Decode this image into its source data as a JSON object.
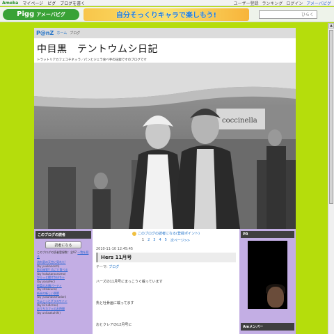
{
  "topbar": {
    "logo": "Ameba",
    "links": [
      "マイページ",
      "ピグ",
      "ブログを書く"
    ],
    "right_links": [
      "ユーザー登録",
      "ランキング",
      "ログイン"
    ],
    "right_highlight": "アメーバピグ"
  },
  "banner": {
    "pigg_mark": "Pigg",
    "pigg_label": "アメーバピグ",
    "ad_text": "自分そっくりキャラで楽しもう!",
    "search_placeholder": "ひらく"
  },
  "crumb": {
    "brand": "P@nZ",
    "home": "ホーム",
    "current": "ブログ"
  },
  "header": {
    "title": "中目黒　テントウムシ日記",
    "description": "トラットリアカフェコチネッラ／パンとジェラ食べ手の記録ですのブログです"
  },
  "photo": {
    "sign_text": "coccinella"
  },
  "left": {
    "reader_head": "このブログの読者",
    "reader_button": "読者になる",
    "note": "このブログの読者登録数：全97",
    "note_link": "一覧を見る",
    "entries": [
      {
        "title": "流れ星の天空に見れた!",
        "author": "(by yuukanosm)"
      },
      {
        "title": "秋の味覚!! 丸ごと食べる",
        "author": "(by hakukarounomo)"
      },
      {
        "title": "からっと揚げかぼちゃ",
        "author": "(by yasu9ec)"
      },
      {
        "title": "根菜のお鍋パーティ",
        "author": "(by sitaakuiro)"
      },
      {
        "title": "新米の新しい季節",
        "author": "(by yusuhaosmadan)"
      },
      {
        "title": "ちょこっとグラスワイン",
        "author": "(by k2ru9ccoo)"
      },
      {
        "title": "おうちカフェのお時間",
        "author": "(by unitaakuhihi)"
      }
    ]
  },
  "center": {
    "reader_link": "このブログの読者になる(登録ポイント)",
    "pager": [
      "1",
      "2",
      "3",
      "4",
      "5",
      "次ページ>>"
    ],
    "pager_current": "1",
    "date": "2010-11-10 12:45:45",
    "entry_title": "Hers 11月号",
    "theme_label": "テーマ:",
    "theme_link": "ブログ",
    "body": [
      "ハーズの11月号にまっこうぐ載っています",
      "魚と吐骨画に載ってます",
      "おとクレアの12月号に"
    ]
  },
  "right": {
    "pr_head": "PR",
    "member_head": "Amメンバー"
  },
  "colors": {
    "background": "#b5dd0c",
    "sidebar": "#c3aee4",
    "link": "#1b6fc8"
  }
}
